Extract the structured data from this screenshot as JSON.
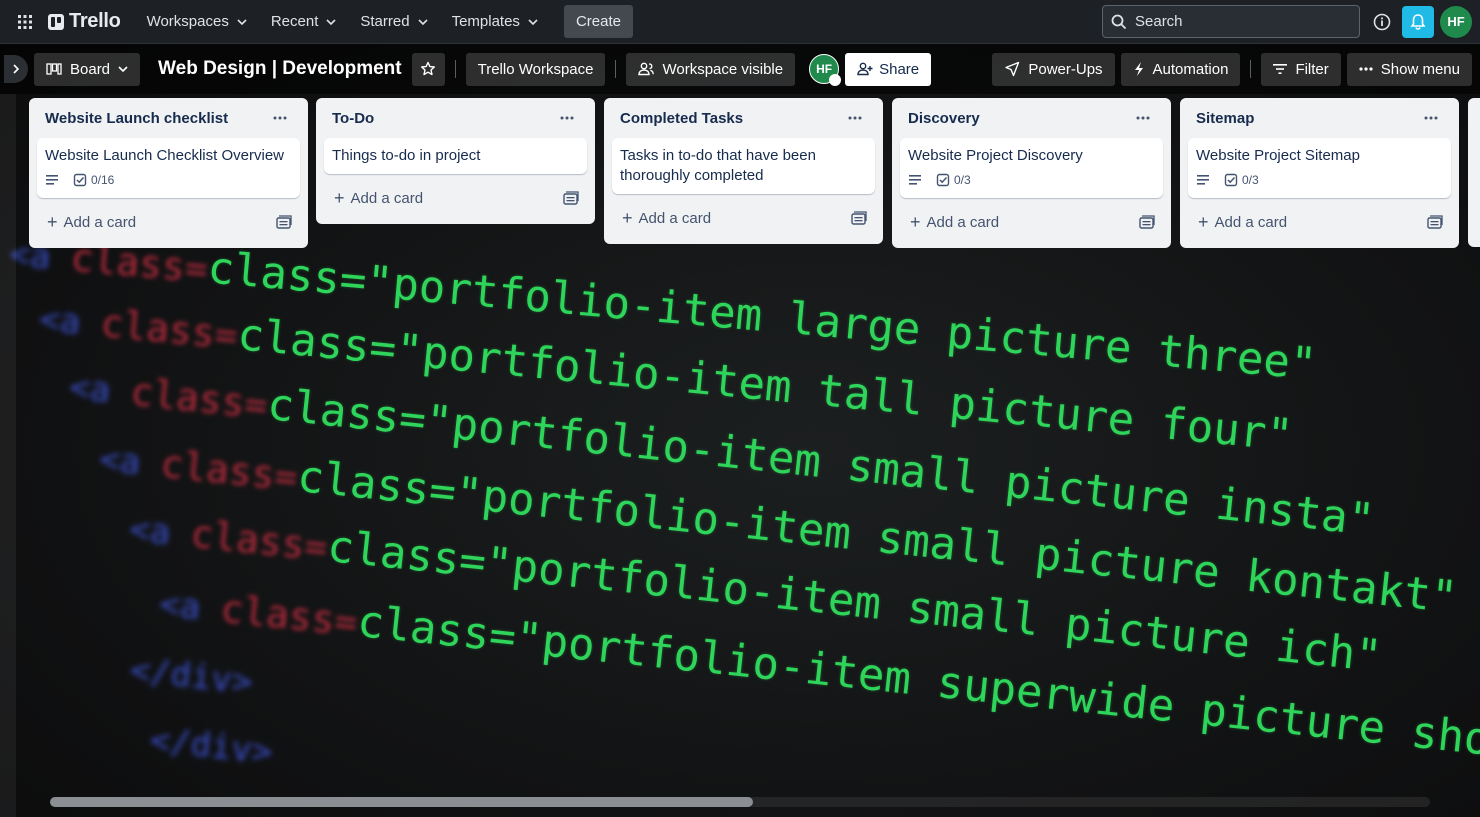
{
  "topbar": {
    "logo_text": "Trello",
    "nav": [
      {
        "label": "Workspaces"
      },
      {
        "label": "Recent"
      },
      {
        "label": "Starred"
      },
      {
        "label": "Templates"
      }
    ],
    "create_label": "Create",
    "search_placeholder": "Search",
    "avatar_initials": "HF",
    "bell_color": "#1FBBE6",
    "avatar_color": "#1F8A4C"
  },
  "boardbar": {
    "view_label": "Board",
    "title": "Web Design | Development",
    "workspace_label": "Trello Workspace",
    "visibility_label": "Workspace visible",
    "member_initials": "HF",
    "share_label": "Share",
    "powerups_label": "Power-Ups",
    "automation_label": "Automation",
    "filter_label": "Filter",
    "menu_label": "Show menu"
  },
  "lists": [
    {
      "title": "Website Launch checklist",
      "cards": [
        {
          "title": "Website Launch Checklist Overview",
          "has_description": true,
          "checklist": "0/16"
        }
      ],
      "add_label": "Add a card"
    },
    {
      "title": "To-Do",
      "cards": [
        {
          "title": "Things to-do in project",
          "has_description": false,
          "checklist": ""
        }
      ],
      "add_label": "Add a card"
    },
    {
      "title": "Completed Tasks",
      "cards": [
        {
          "title": "Tasks in to-do that have been thoroughly completed",
          "has_description": false,
          "checklist": ""
        }
      ],
      "add_label": "Add a card"
    },
    {
      "title": "Discovery",
      "cards": [
        {
          "title": "Website Project Discovery",
          "has_description": true,
          "checklist": "0/3"
        }
      ],
      "add_label": "Add a card"
    },
    {
      "title": "Sitemap",
      "cards": [
        {
          "title": "Website Project Sitemap",
          "has_description": true,
          "checklist": "0/3"
        }
      ],
      "add_label": "Add a card"
    }
  ],
  "background": {
    "lines": [
      "class=\"portfolio-item large picture three\"",
      "class=\"portfolio-item tall picture four\"",
      "class=\"portfolio-item small picture insta\"",
      "class=\"portfolio-item small picture kontakt\"",
      "class=\"portfolio-item small picture ich\"",
      "class=\"portfolio-item superwide picture shooting\""
    ]
  }
}
